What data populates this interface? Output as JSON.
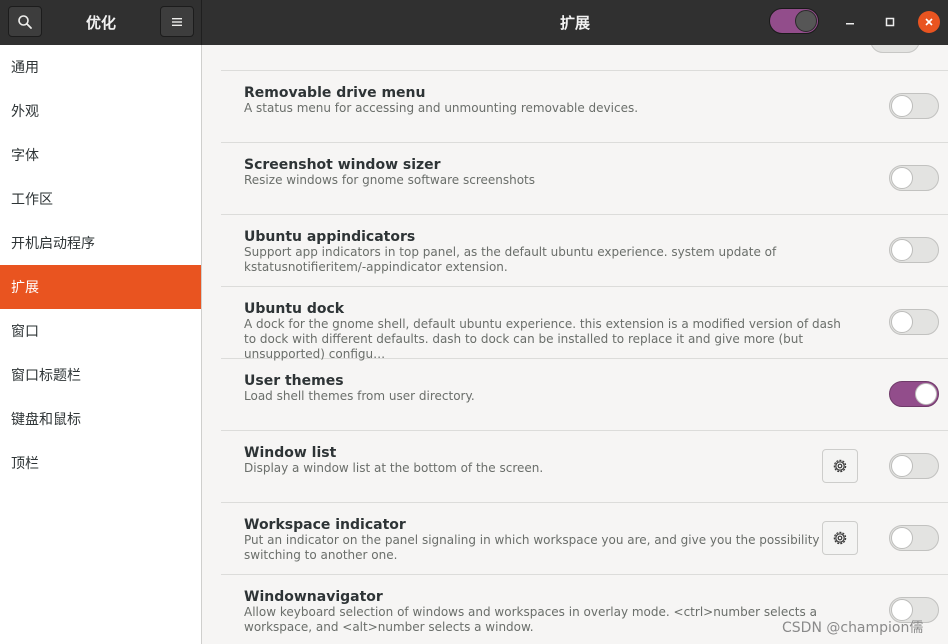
{
  "window": {
    "sidebar_title": "优化",
    "title": "扩展",
    "global_switch_on": true
  },
  "sidebar": {
    "items": [
      {
        "label": "通用",
        "active": false
      },
      {
        "label": "外观",
        "active": false
      },
      {
        "label": "字体",
        "active": false
      },
      {
        "label": "工作区",
        "active": false
      },
      {
        "label": "开机启动程序",
        "active": false
      },
      {
        "label": "扩展",
        "active": true
      },
      {
        "label": "窗口",
        "active": false
      },
      {
        "label": "窗口标题栏",
        "active": false
      },
      {
        "label": "键盘和鼠标",
        "active": false
      },
      {
        "label": "顶栏",
        "active": false
      }
    ]
  },
  "extensions": [
    {
      "title": "Removable drive menu",
      "description": "A status menu for accessing and unmounting removable devices.",
      "enabled": false,
      "has_settings": false
    },
    {
      "title": "Screenshot window sizer",
      "description": "Resize windows for gnome software screenshots",
      "enabled": false,
      "has_settings": false
    },
    {
      "title": "Ubuntu appindicators",
      "description": "Support app indicators in top panel, as the default ubuntu experience. system update of kstatusnotifieritem/-appindicator extension.",
      "enabled": false,
      "has_settings": false
    },
    {
      "title": "Ubuntu dock",
      "description": "A dock for the gnome shell, default ubuntu experience. this extension is a modified version of dash to dock with different defaults. dash to dock can be installed to replace it and give more (but unsupported) configu…",
      "enabled": false,
      "has_settings": false
    },
    {
      "title": "User themes",
      "description": "Load shell themes from user directory.",
      "enabled": true,
      "has_settings": false
    },
    {
      "title": "Window list",
      "description": "Display a window list at the bottom of the screen.",
      "enabled": false,
      "has_settings": true
    },
    {
      "title": "Workspace indicator",
      "description": "Put an indicator on the panel signaling in which workspace you are, and give you the possibility of switching to another one.",
      "enabled": false,
      "has_settings": true
    },
    {
      "title": "Windownavigator",
      "description": "Allow keyboard selection of windows and workspaces in overlay mode. <ctrl>number selects a workspace, and <alt>number selects a window.",
      "enabled": false,
      "has_settings": false
    }
  ],
  "watermark": "CSDN @champion儒",
  "colors": {
    "accent": "#e95420",
    "switch_on": "#924d8b",
    "header": "#303030"
  },
  "icons": {
    "search": "search-icon",
    "menu": "hamburger-menu-icon",
    "settings": "gear-icon",
    "minimize": "minimize-icon",
    "maximize": "maximize-icon",
    "close": "close-icon"
  }
}
